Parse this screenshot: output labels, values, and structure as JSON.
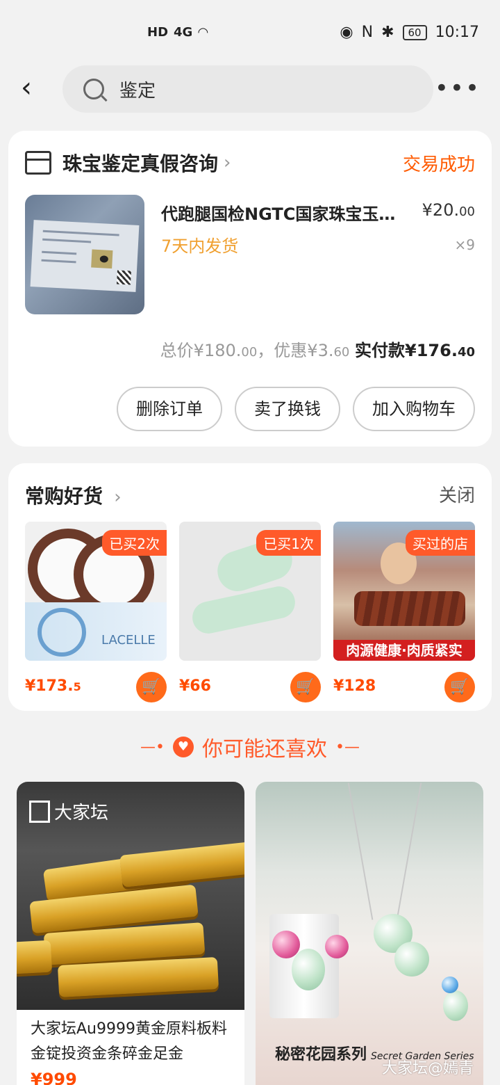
{
  "status_bar": {
    "network": "HD",
    "signal": "4G",
    "battery": "60",
    "time": "10:17"
  },
  "search": {
    "query": "鉴定"
  },
  "order": {
    "shop_name": "珠宝鉴定真假咨询",
    "status": "交易成功",
    "item_title": "代跑腿国检NGTC国家珠宝玉石检测中心鉴定证书",
    "price_int": "¥20.",
    "price_dec": "00",
    "shipping": "7天内发货",
    "quantity": "×9",
    "total_label": "总价",
    "total_int": "¥180.",
    "total_dec": "00",
    "discount_label": "，优惠",
    "discount_int": "¥3.",
    "discount_dec": "60",
    "paid_label": "实付款",
    "paid_int": "¥176.",
    "paid_dec": "40",
    "buttons": [
      "删除订单",
      "卖了换钱",
      "加入购物车"
    ]
  },
  "frequent": {
    "title": "常购好货",
    "close": "关闭",
    "products": [
      {
        "tag": "已买2次",
        "price_int": "¥173.",
        "price_dec": "5",
        "box_text": "LACELLE"
      },
      {
        "tag": "已买1次",
        "price_int": "¥66",
        "price_dec": ""
      },
      {
        "tag": "买过的店",
        "price_int": "¥128",
        "price_dec": "",
        "banner": "肉源健康·肉质紧实"
      }
    ]
  },
  "recommend": {
    "title": "你可能还喜欢",
    "items": [
      {
        "logo": "大家坛",
        "text": "大家坛Au9999黄金原料板料金锭投资金条碎金足金",
        "price": "¥999"
      },
      {
        "caption": "秘密花园系列",
        "caption_en": "Secret Garden Series",
        "watermark": "大家坛@嫣青"
      }
    ]
  }
}
